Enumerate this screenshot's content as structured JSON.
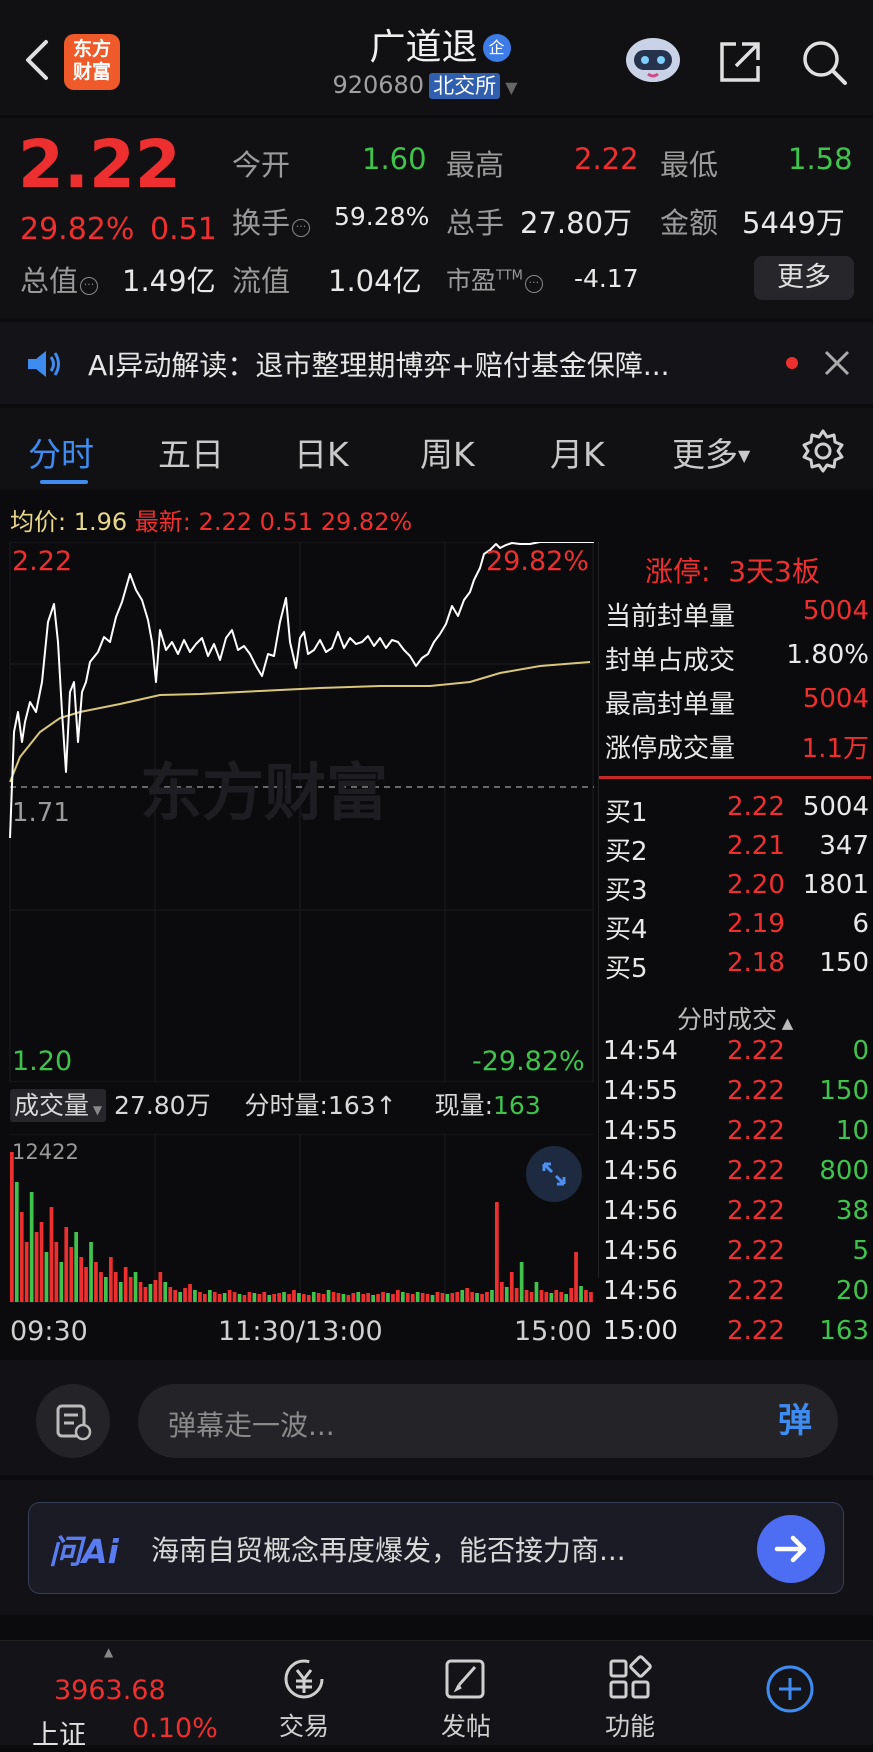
{
  "header": {
    "logo_line1": "东方",
    "logo_line2": "财富",
    "stock_name": "广道退",
    "badge": "企",
    "stock_code": "920680",
    "exchange": "北交所"
  },
  "quote": {
    "price": "2.22",
    "change_pct": "29.82%",
    "change": "0.51",
    "fields": [
      {
        "label": "今开",
        "value": "1.60",
        "color": "green"
      },
      {
        "label": "最高",
        "value": "2.22",
        "color": "red"
      },
      {
        "label": "最低",
        "value": "1.58",
        "color": "green"
      },
      {
        "label": "换手",
        "value": "59.28%",
        "color": "white"
      },
      {
        "label": "总手",
        "value": "27.80万",
        "color": "white"
      },
      {
        "label": "金额",
        "value": "5449万",
        "color": "white"
      },
      {
        "label": "总值",
        "value": "1.49亿",
        "color": "white"
      },
      {
        "label": "流值",
        "value": "1.04亿",
        "color": "white"
      },
      {
        "label": "市盈",
        "sup": "TTM",
        "value": "-4.17",
        "color": "white"
      }
    ],
    "more_label": "更多"
  },
  "ai_news": {
    "text": "AI异动解读：退市整理期博弈+赔付基金保障..."
  },
  "tabs": [
    "分时",
    "五日",
    "日K",
    "周K",
    "月K",
    "更多"
  ],
  "chart_header": {
    "avg_label": "均价:",
    "avg_value": "1.96",
    "latest_label": "最新:",
    "latest_value": "2.22",
    "latest_change": "0.51",
    "latest_pct": "29.82%"
  },
  "price_chart": {
    "top_price": "2.22",
    "top_pct": "29.82%",
    "mid_price": "1.71",
    "bottom_price": "1.20",
    "bottom_pct": "-29.82%",
    "watermark": "东方财富"
  },
  "volume_header": {
    "label": "成交量",
    "total": "27.80万",
    "tick_label": "分时量:163↑",
    "now_label": "现量:",
    "now_value": "163",
    "max_label": "12422"
  },
  "time_axis": [
    "09:30",
    "11:30/13:00",
    "15:00"
  ],
  "limit_panel": {
    "title": "涨停:  3天3板",
    "rows": [
      {
        "label": "当前封单量",
        "value": "5004",
        "color": "red"
      },
      {
        "label": "封单占成交",
        "value": "1.80%",
        "color": "white"
      },
      {
        "label": "最高封单量",
        "value": "5004",
        "color": "red"
      },
      {
        "label": "涨停成交量",
        "value": "1.1万",
        "color": "red"
      }
    ]
  },
  "order_book": [
    {
      "label": "买1",
      "price": "2.22",
      "vol": "5004"
    },
    {
      "label": "买2",
      "price": "2.21",
      "vol": "347"
    },
    {
      "label": "买3",
      "price": "2.20",
      "vol": "1801"
    },
    {
      "label": "买4",
      "price": "2.19",
      "vol": "6"
    },
    {
      "label": "买5",
      "price": "2.18",
      "vol": "150"
    }
  ],
  "ticks_title": "分时成交",
  "ticks": [
    {
      "time": "14:54",
      "price": "2.22",
      "vol": "0"
    },
    {
      "time": "14:55",
      "price": "2.22",
      "vol": "150"
    },
    {
      "time": "14:55",
      "price": "2.22",
      "vol": "10"
    },
    {
      "time": "14:56",
      "price": "2.22",
      "vol": "800"
    },
    {
      "time": "14:56",
      "price": "2.22",
      "vol": "38"
    },
    {
      "time": "14:56",
      "price": "2.22",
      "vol": "5"
    },
    {
      "time": "14:56",
      "price": "2.22",
      "vol": "20"
    },
    {
      "time": "15:00",
      "price": "2.22",
      "vol": "163"
    }
  ],
  "danmu": {
    "placeholder": "弹幕走一波...",
    "send": "弹"
  },
  "wenai": {
    "logo": "问Ai",
    "text": "海南自贸概念再度爆发，能否接力商..."
  },
  "bottom_tabs": {
    "index_value": "3963.68",
    "index_name": "上证",
    "index_pct": "0.10%",
    "items": [
      "交易",
      "发帖",
      "功能"
    ]
  },
  "colors": {
    "red": "#ee2f2f",
    "green": "#3fc34c",
    "avg_line": "#d8c77a",
    "accent": "#3b82f6"
  }
}
